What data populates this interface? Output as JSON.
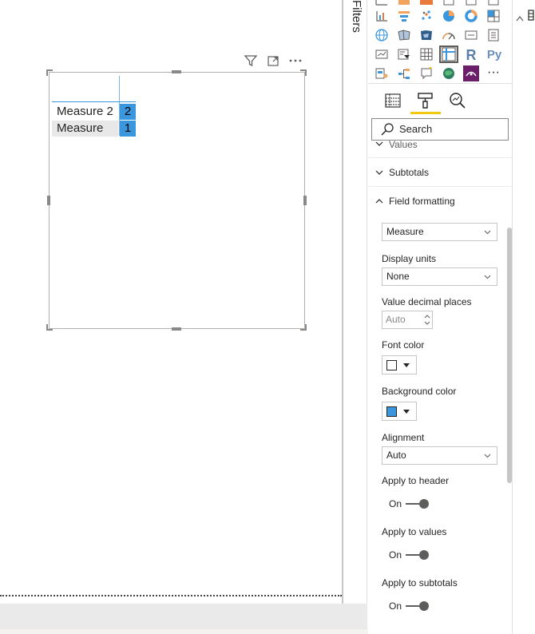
{
  "canvas": {
    "visual_header": {
      "filter_icon": "filter-icon",
      "focus_icon": "focus-mode-icon",
      "more_icon": "more-options-icon"
    },
    "table": {
      "rows": [
        {
          "label": "Measure 2",
          "value": "2"
        },
        {
          "label": "Measure",
          "value": "1"
        }
      ]
    }
  },
  "filters": {
    "label": "Filters"
  },
  "pane": {
    "visualizations_icons": [
      "line-chart",
      "funnel",
      "scatter",
      "pie",
      "donut",
      "treemap",
      "map",
      "filled-map",
      "shape-map",
      "gauge",
      "card",
      "multi-row-card",
      "kpi",
      "slicer",
      "table",
      "matrix",
      "r-visual",
      "python-visual",
      "key-influencers",
      "decomposition-tree",
      "qa",
      "arcgis-map",
      "custom-visual",
      "more"
    ],
    "r_label": "R",
    "py_label": "Py",
    "more_label": "···",
    "tabs": [
      "fields-tab",
      "format-tab",
      "analytics-tab"
    ],
    "search_placeholder": "Search",
    "sections": {
      "values": "Values",
      "subtotals": "Subtotals",
      "field_formatting": "Field formatting"
    },
    "field_formatting": {
      "field_select": "Measure",
      "display_units_label": "Display units",
      "display_units_value": "None",
      "decimal_places_label": "Value decimal places",
      "decimal_places_value": "Auto",
      "font_color_label": "Font color",
      "font_color": "#ffffff",
      "background_color_label": "Background color",
      "background_color": "#3a96dd",
      "alignment_label": "Alignment",
      "alignment_value": "Auto",
      "apply_header_label": "Apply to header",
      "apply_header_state": "On",
      "apply_values_label": "Apply to values",
      "apply_values_state": "On",
      "apply_subtotals_label": "Apply to subtotals",
      "apply_subtotals_state": "On"
    }
  },
  "colors": {
    "accent_yellow": "#f2c811",
    "selection_blue": "#3a96dd"
  }
}
